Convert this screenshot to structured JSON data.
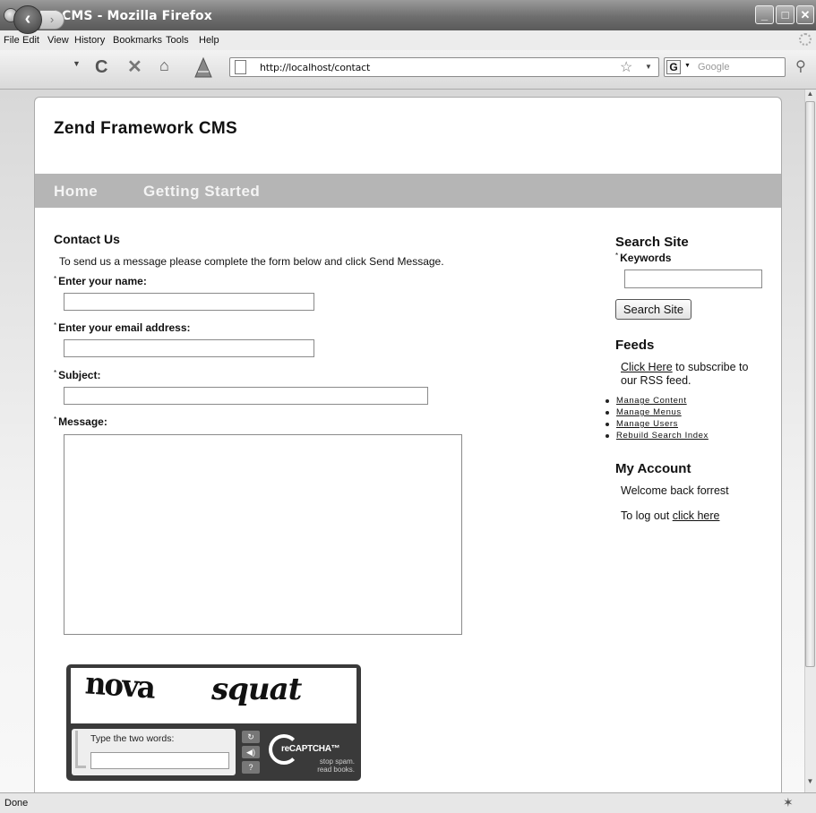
{
  "window": {
    "title": "Zend CMS - Mozilla Firefox"
  },
  "menubar": {
    "items": [
      "File",
      "Edit",
      "View",
      "History",
      "Bookmarks",
      "Tools",
      "Help"
    ]
  },
  "navbar": {
    "url": "http://localhost/contact",
    "search_engine": "G",
    "search_placeholder": "Google"
  },
  "site": {
    "title": "Zend Framework CMS",
    "nav": [
      "Home",
      "Getting Started"
    ]
  },
  "contact": {
    "heading": "Contact Us",
    "intro": "To send us a message please complete the form below and click Send Message.",
    "name_label": "Enter your name:",
    "email_label": "Enter your email address:",
    "subject_label": "Subject:",
    "message_label": "Message:",
    "required_mark": "*"
  },
  "captcha": {
    "word1": "nova",
    "word2": "squat",
    "prompt": "Type the two words:",
    "brand": "reCAPTCHA™",
    "tagline1": "stop spam.",
    "tagline2": "read books."
  },
  "sidebar": {
    "search_heading": "Search Site",
    "keywords_label": "Keywords",
    "search_button": "Search Site",
    "feeds_heading": "Feeds",
    "feeds_link": "Click Here",
    "feeds_text1": " to subscribe to",
    "feeds_text2": "our RSS feed.",
    "admin_links": [
      "Manage Content",
      "Manage Menus",
      "Manage Users",
      "Rebuild Search Index"
    ],
    "account_heading": "My Account",
    "welcome": "Welcome back forrest",
    "logout_text": "To log out ",
    "logout_link": "click here"
  },
  "status": {
    "text": "Done"
  },
  "icons": [
    "firefox-icon",
    "back-icon",
    "forward-icon",
    "reload-icon",
    "stop-icon",
    "home-icon",
    "addon-icon",
    "page-icon",
    "star-icon",
    "search-magnifier-icon",
    "refresh-icon",
    "audio-icon",
    "help-icon"
  ]
}
